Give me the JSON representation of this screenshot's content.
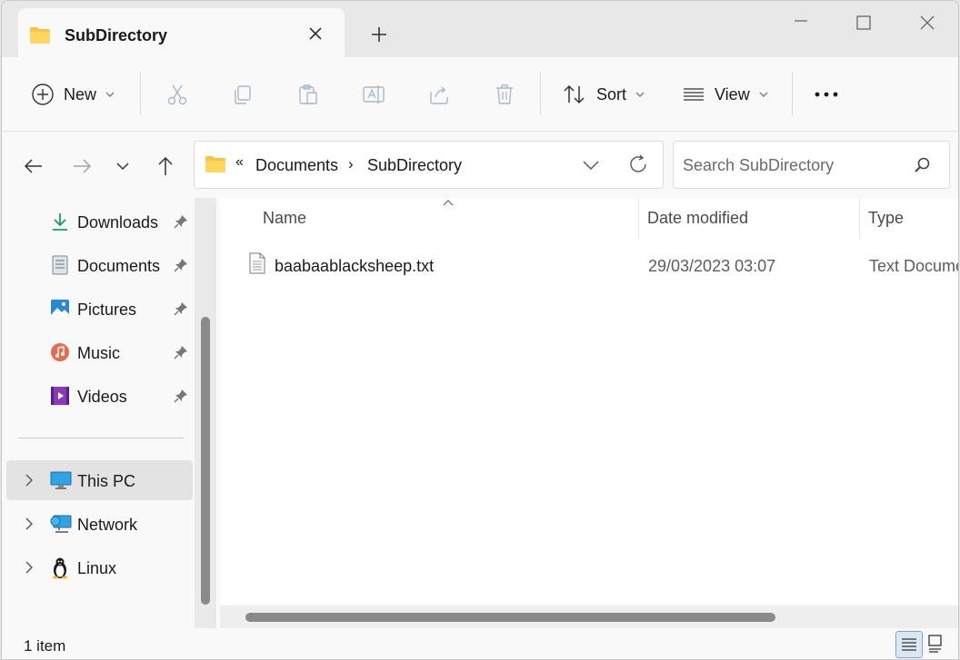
{
  "tab": {
    "title": "SubDirectory",
    "close_icon": "close-icon",
    "new_tab_icon": "plus-icon"
  },
  "window_controls": [
    "minimize-icon",
    "maximize-icon",
    "close-icon"
  ],
  "commandbar": {
    "new_label": "New",
    "sort_label": "Sort",
    "view_label": "View",
    "tools": [
      "cut-icon",
      "copy-icon",
      "paste-icon",
      "rename-icon",
      "share-icon",
      "delete-icon"
    ],
    "more_icon": "more-icon"
  },
  "address": {
    "overflow": "«",
    "crumbs": [
      "Documents",
      "SubDirectory"
    ],
    "separator": "›"
  },
  "search": {
    "placeholder": "Search SubDirectory"
  },
  "sidebar": {
    "quick_access": [
      {
        "label": "Downloads",
        "icon": "downloads-icon",
        "pinned": true
      },
      {
        "label": "Documents",
        "icon": "documents-icon",
        "pinned": true
      },
      {
        "label": "Pictures",
        "icon": "pictures-icon",
        "pinned": true
      },
      {
        "label": "Music",
        "icon": "music-icon",
        "pinned": true
      },
      {
        "label": "Videos",
        "icon": "videos-icon",
        "pinned": true
      }
    ],
    "locations": [
      {
        "label": "This PC",
        "icon": "this-pc-icon",
        "selected": true
      },
      {
        "label": "Network",
        "icon": "network-icon",
        "selected": false
      },
      {
        "label": "Linux",
        "icon": "linux-icon",
        "selected": false
      }
    ]
  },
  "columns": {
    "name": "Name",
    "date": "Date modified",
    "type": "Type"
  },
  "files": [
    {
      "name": "baabaablacksheep.txt",
      "date": "29/03/2023 03:07",
      "type": "Text Document",
      "icon": "text-file-icon"
    }
  ],
  "status": {
    "count": "1 item"
  },
  "colors": {
    "accent": "#0067c0",
    "folder": "#f4c542",
    "selected_bg": "#e3e3e3"
  }
}
